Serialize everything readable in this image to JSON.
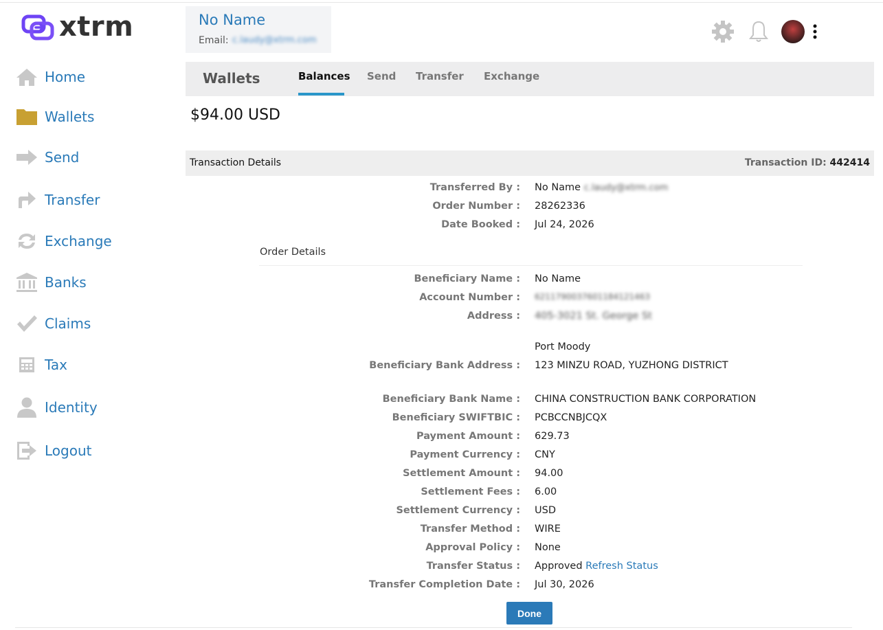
{
  "brand": {
    "name": "xtrm",
    "color": "#6e44f5"
  },
  "user": {
    "name": "No Name",
    "email_label": "Email:",
    "email": "c.laudy@xtrm.com"
  },
  "header": {
    "icons": [
      "gear-icon",
      "bell-icon",
      "avatar",
      "kebab-menu-icon"
    ]
  },
  "sidebar": {
    "items": [
      {
        "label": "Home",
        "icon": "home-icon"
      },
      {
        "label": "Wallets",
        "icon": "folder-icon"
      },
      {
        "label": "Send",
        "icon": "arrow-right-icon"
      },
      {
        "label": "Transfer",
        "icon": "transfer-arrow-icon"
      },
      {
        "label": "Exchange",
        "icon": "exchange-icon"
      },
      {
        "label": "Banks",
        "icon": "bank-icon"
      },
      {
        "label": "Claims",
        "icon": "checkmark-icon"
      },
      {
        "label": "Tax",
        "icon": "calculator-icon"
      },
      {
        "label": "Identity",
        "icon": "person-icon"
      },
      {
        "label": "Logout",
        "icon": "logout-icon"
      }
    ],
    "active": "Wallets"
  },
  "tabs": {
    "title": "Wallets",
    "items": [
      "Balances",
      "Send",
      "Transfer",
      "Exchange"
    ],
    "active": "Balances"
  },
  "balance": "$94.00 USD",
  "transaction": {
    "section_title": "Transaction Details",
    "id_label": "Transaction ID:",
    "id_value": "442414"
  },
  "top_fields": [
    {
      "label": "Transferred By",
      "value": "No Name",
      "extra": "c.laudy@xtrm.com"
    },
    {
      "label": "Order Number",
      "value": "28262336"
    },
    {
      "label": "Date Booked",
      "value": "Jul 24, 2026"
    }
  ],
  "order_details_title": "Order Details",
  "order_fields": [
    {
      "label": "Beneficiary Name",
      "value": "No Name"
    },
    {
      "label": "Account Number",
      "value": "6211790037601184121463"
    },
    {
      "label": "Address",
      "value": "405-3021 St. George St"
    },
    {
      "label": "",
      "value": "Port Moody"
    },
    {
      "label": "Beneficiary Bank Address",
      "value": "123 MINZU ROAD, YUZHONG DISTRICT"
    },
    {
      "label": "Beneficiary Bank Name",
      "value": "CHINA CONSTRUCTION BANK CORPORATION"
    },
    {
      "label": "Beneficiary SWIFTBIC",
      "value": "PCBCCNBJCQX"
    },
    {
      "label": "Payment Amount",
      "value": "629.73"
    },
    {
      "label": "Payment Currency",
      "value": "CNY"
    },
    {
      "label": "Settlement Amount",
      "value": "94.00"
    },
    {
      "label": "Settlement Fees",
      "value": "6.00"
    },
    {
      "label": "Settlement Currency",
      "value": "USD"
    },
    {
      "label": "Transfer Method",
      "value": "WIRE"
    },
    {
      "label": "Approval Policy",
      "value": "None"
    },
    {
      "label": "Transfer Status",
      "value": "Approved",
      "link": "Refresh Status"
    },
    {
      "label": "Transfer Completion Date",
      "value": "Jul 30, 2026"
    }
  ],
  "done_button": "Done"
}
